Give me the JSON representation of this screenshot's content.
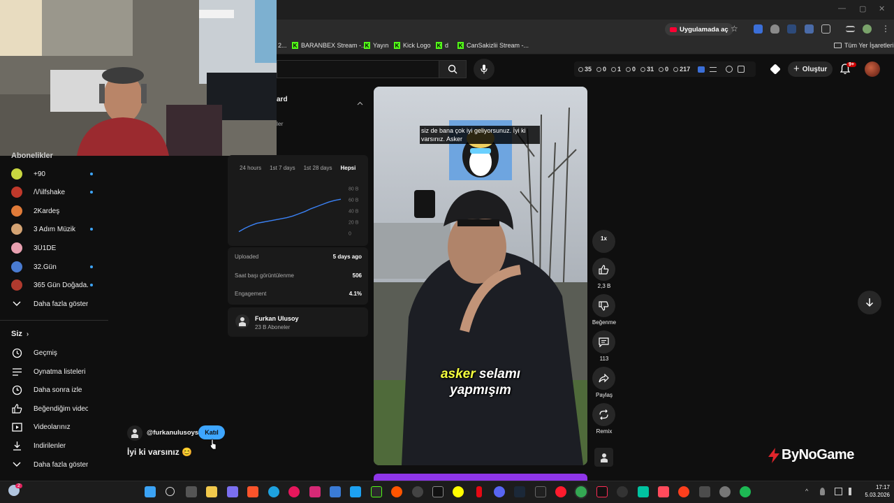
{
  "browser": {
    "open_in_app_label": "Uygulamada aç",
    "bookmarks": [
      {
        "label": "BARANBEX Stream -..."
      },
      {
        "label": "Yayın"
      },
      {
        "label": "Kick Logo"
      },
      {
        "label": "d"
      },
      {
        "label": "CanSakizlii Stream -..."
      }
    ],
    "truncated_bookmark": "2...",
    "all_bookmarks_label": "Tüm Yer İşaretleri"
  },
  "header": {
    "stats": [
      {
        "icon": "clock-icon",
        "value": "35"
      },
      {
        "icon": "circle-icon",
        "value": "0"
      },
      {
        "icon": "circle-icon",
        "value": "1"
      },
      {
        "icon": "circle-icon",
        "value": "0"
      },
      {
        "icon": "circle-icon",
        "value": "31"
      },
      {
        "icon": "circle-icon",
        "value": "0"
      },
      {
        "icon": "person-icon",
        "value": "217"
      }
    ],
    "create_label": "Oluştur",
    "notification_badge": "9+"
  },
  "sidebar": {
    "subscriptions_title": "Abonelikler",
    "channels": [
      {
        "label": "+90",
        "color": "#c8d640",
        "dot": true
      },
      {
        "label": "/\\/\\ilfshake",
        "color": "#c0392b",
        "dot": true
      },
      {
        "label": "2Kardeş",
        "color": "#e07b39",
        "dot": false
      },
      {
        "label": "3 Adım Müzik",
        "color": "#d4a373",
        "dot": true
      },
      {
        "label": "3Ü1DE",
        "color": "#e8a0b0",
        "dot": false
      },
      {
        "label": "32.Gün",
        "color": "#4a7bd0",
        "dot": true
      },
      {
        "label": "365 Gün Doğada...",
        "color": "#b03a2e",
        "dot": true
      }
    ],
    "show_more_label": "Daha fazla göster",
    "you_title": "Siz",
    "you_items": [
      {
        "icon": "history-icon",
        "label": "Geçmiş"
      },
      {
        "icon": "playlist-icon",
        "label": "Oynatma listeleri"
      },
      {
        "icon": "watch-later-icon",
        "label": "Daha sonra izle"
      },
      {
        "icon": "thumbs-up-icon",
        "label": "Beğendiğim videolar"
      },
      {
        "icon": "video-icon",
        "label": "Videolarınız"
      },
      {
        "icon": "download-icon",
        "label": "İndirilenler"
      }
    ],
    "you_show_more_label": "Daha fazla göster"
  },
  "stats_panel": {
    "title_partial": "ard",
    "subtitle_partial": "ler",
    "tabs": [
      "24 hours",
      "1st 7 days",
      "1st 28 days",
      "Hepsi"
    ],
    "active_tab": "Hepsi",
    "uploaded_label": "Uploaded",
    "uploaded_value": "5 days ago",
    "views_per_hour_label": "Saat başı görüntülenme",
    "views_per_hour_value": "506",
    "engagement_label": "Engagement",
    "engagement_value": "4.1%",
    "channel_name": "Furkan Ulusoy",
    "channel_subs": "23 B Aboneler"
  },
  "chart_data": {
    "type": "line",
    "title": "",
    "xlabel": "",
    "ylabel": "",
    "y_tick_labels": [
      "80 B",
      "60 B",
      "40 B",
      "20 B",
      "0"
    ],
    "ylim": [
      0,
      80000
    ],
    "grid": false,
    "series": [
      {
        "values": [
          3000,
          9000,
          14000,
          18000,
          20000,
          22000,
          24000,
          26000,
          28000,
          31000,
          35000,
          39000,
          44000,
          48000,
          52000,
          56000,
          59000,
          61000
        ]
      }
    ]
  },
  "video": {
    "caption_text": "siz de bana çok iyi geliyorsunuz. İyi ki varsınız. Asker",
    "subtitle_highlight": "asker",
    "subtitle_rest": "selamı",
    "subtitle_line2": "yapmışım"
  },
  "rail": {
    "speed_label": "1x",
    "likes": "2,3 B",
    "dislike_label": "Beğenme",
    "comments": "113",
    "share_label": "Paylaş",
    "remix_label": "Remix"
  },
  "comment_overlay": {
    "handle": "@furkanulusoys",
    "join_label": "Katıl",
    "text": "İyi ki varsınız 😊"
  },
  "watermark": "ByNoGame",
  "taskbar": {
    "time": "17:17",
    "date": "5.03.2026",
    "weather_badge": "2"
  }
}
